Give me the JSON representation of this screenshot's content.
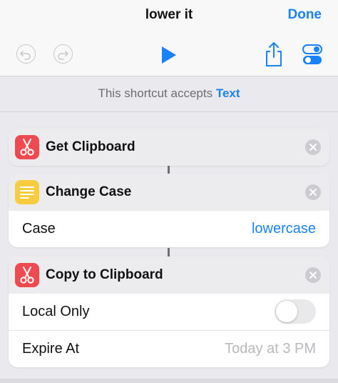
{
  "header": {
    "title": "lower it",
    "done_label": "Done",
    "icons": [
      "undo-icon",
      "redo-icon",
      "play-icon",
      "share-icon",
      "settings-toggle-icon"
    ]
  },
  "accepts": {
    "prefix": "This shortcut accepts",
    "type": "Text"
  },
  "actions": [
    {
      "title": "Get Clipboard",
      "icon": "scissors-icon",
      "icon_color": "#ef4a4f"
    },
    {
      "title": "Change Case",
      "icon": "text-lines-icon",
      "icon_color": "#f7cd3f",
      "params": [
        {
          "label": "Case",
          "value": "lowercase"
        }
      ]
    },
    {
      "title": "Copy to Clipboard",
      "icon": "scissors-icon",
      "icon_color": "#ef4a4f",
      "params": [
        {
          "label": "Local Only",
          "toggle": false
        },
        {
          "label": "Expire At",
          "value": "Today at 3 PM"
        }
      ]
    }
  ],
  "colors": {
    "accent": "#1a82f7",
    "background": "#e9e9ee",
    "card_header": "#ececef"
  }
}
